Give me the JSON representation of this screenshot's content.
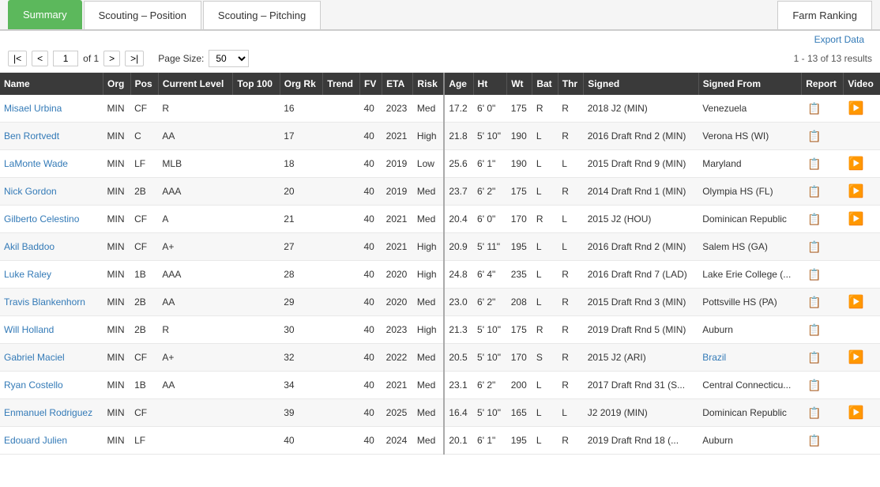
{
  "tabs": [
    {
      "label": "Summary",
      "active": true
    },
    {
      "label": "Scouting – Position",
      "active": false
    },
    {
      "label": "Scouting – Pitching",
      "active": false
    },
    {
      "label": "Farm Ranking",
      "active": false
    }
  ],
  "toolbar": {
    "export_label": "Export Data",
    "page_current": "1",
    "page_of": "of 1",
    "page_size_label": "Page Size:",
    "page_size_value": "50",
    "results_label": "1 - 13 of 13 results"
  },
  "table": {
    "headers": [
      "Name",
      "Org",
      "Pos",
      "Current Level",
      "Top 100",
      "Org Rk",
      "Trend",
      "FV",
      "ETA",
      "Risk",
      "Age",
      "Ht",
      "Wt",
      "Bat",
      "Thr",
      "Signed",
      "Signed From",
      "Report",
      "Video"
    ],
    "rows": [
      {
        "name": "Misael Urbina",
        "org": "MIN",
        "pos": "CF",
        "current_level": "R",
        "top100": "",
        "org_rk": "16",
        "trend": "",
        "fv": "40",
        "eta": "2023",
        "risk": "Med",
        "age": "17.2",
        "ht": "6' 0\"",
        "wt": "175",
        "bat": "R",
        "thr": "R",
        "signed": "2018 J2 (MIN)",
        "signed_from": "Venezuela",
        "has_report": true,
        "has_video": true,
        "signed_from_link": false
      },
      {
        "name": "Ben Rortvedt",
        "org": "MIN",
        "pos": "C",
        "current_level": "AA",
        "top100": "",
        "org_rk": "17",
        "trend": "",
        "fv": "40",
        "eta": "2021",
        "risk": "High",
        "age": "21.8",
        "ht": "5' 10\"",
        "wt": "190",
        "bat": "L",
        "thr": "R",
        "signed": "2016 Draft Rnd 2 (MIN)",
        "signed_from": "Verona HS (WI)",
        "has_report": true,
        "has_video": false,
        "signed_from_link": false
      },
      {
        "name": "LaMonte Wade",
        "org": "MIN",
        "pos": "LF",
        "current_level": "MLB",
        "top100": "",
        "org_rk": "18",
        "trend": "",
        "fv": "40",
        "eta": "2019",
        "risk": "Low",
        "age": "25.6",
        "ht": "6' 1\"",
        "wt": "190",
        "bat": "L",
        "thr": "L",
        "signed": "2015 Draft Rnd 9 (MIN)",
        "signed_from": "Maryland",
        "has_report": true,
        "has_video": true,
        "signed_from_link": false
      },
      {
        "name": "Nick Gordon",
        "org": "MIN",
        "pos": "2B",
        "current_level": "AAA",
        "top100": "",
        "org_rk": "20",
        "trend": "",
        "fv": "40",
        "eta": "2019",
        "risk": "Med",
        "age": "23.7",
        "ht": "6' 2\"",
        "wt": "175",
        "bat": "L",
        "thr": "R",
        "signed": "2014 Draft Rnd 1 (MIN)",
        "signed_from": "Olympia HS (FL)",
        "has_report": true,
        "has_video": true,
        "signed_from_link": false
      },
      {
        "name": "Gilberto Celestino",
        "org": "MIN",
        "pos": "CF",
        "current_level": "A",
        "top100": "",
        "org_rk": "21",
        "trend": "",
        "fv": "40",
        "eta": "2021",
        "risk": "Med",
        "age": "20.4",
        "ht": "6' 0\"",
        "wt": "170",
        "bat": "R",
        "thr": "L",
        "signed": "2015 J2 (HOU)",
        "signed_from": "Dominican Republic",
        "has_report": true,
        "has_video": true,
        "signed_from_link": false
      },
      {
        "name": "Akil Baddoo",
        "org": "MIN",
        "pos": "CF",
        "current_level": "A+",
        "top100": "",
        "org_rk": "27",
        "trend": "",
        "fv": "40",
        "eta": "2021",
        "risk": "High",
        "age": "20.9",
        "ht": "5' 11\"",
        "wt": "195",
        "bat": "L",
        "thr": "L",
        "signed": "2016 Draft Rnd 2 (MIN)",
        "signed_from": "Salem HS (GA)",
        "has_report": true,
        "has_video": false,
        "signed_from_link": false
      },
      {
        "name": "Luke Raley",
        "org": "MIN",
        "pos": "1B",
        "current_level": "AAA",
        "top100": "",
        "org_rk": "28",
        "trend": "",
        "fv": "40",
        "eta": "2020",
        "risk": "High",
        "age": "24.8",
        "ht": "6' 4\"",
        "wt": "235",
        "bat": "L",
        "thr": "R",
        "signed": "2016 Draft Rnd 7 (LAD)",
        "signed_from": "Lake Erie College (...",
        "has_report": true,
        "has_video": false,
        "signed_from_link": false
      },
      {
        "name": "Travis Blankenhorn",
        "org": "MIN",
        "pos": "2B",
        "current_level": "AA",
        "top100": "",
        "org_rk": "29",
        "trend": "",
        "fv": "40",
        "eta": "2020",
        "risk": "Med",
        "age": "23.0",
        "ht": "6' 2\"",
        "wt": "208",
        "bat": "L",
        "thr": "R",
        "signed": "2015 Draft Rnd 3 (MIN)",
        "signed_from": "Pottsville HS (PA)",
        "has_report": true,
        "has_video": true,
        "signed_from_link": false
      },
      {
        "name": "Will Holland",
        "org": "MIN",
        "pos": "2B",
        "current_level": "R",
        "top100": "",
        "org_rk": "30",
        "trend": "",
        "fv": "40",
        "eta": "2023",
        "risk": "High",
        "age": "21.3",
        "ht": "5' 10\"",
        "wt": "175",
        "bat": "R",
        "thr": "R",
        "signed": "2019 Draft Rnd 5 (MIN)",
        "signed_from": "Auburn",
        "has_report": true,
        "has_video": false,
        "signed_from_link": false
      },
      {
        "name": "Gabriel Maciel",
        "org": "MIN",
        "pos": "CF",
        "current_level": "A+",
        "top100": "",
        "org_rk": "32",
        "trend": "",
        "fv": "40",
        "eta": "2022",
        "risk": "Med",
        "age": "20.5",
        "ht": "5' 10\"",
        "wt": "170",
        "bat": "S",
        "thr": "R",
        "signed": "2015 J2 (ARI)",
        "signed_from": "Brazil",
        "has_report": true,
        "has_video": true,
        "signed_from_link": true
      },
      {
        "name": "Ryan Costello",
        "org": "MIN",
        "pos": "1B",
        "current_level": "AA",
        "top100": "",
        "org_rk": "34",
        "trend": "",
        "fv": "40",
        "eta": "2021",
        "risk": "Med",
        "age": "23.1",
        "ht": "6' 2\"",
        "wt": "200",
        "bat": "L",
        "thr": "R",
        "signed": "2017 Draft Rnd 31 (S...",
        "signed_from": "Central Connecticu...",
        "has_report": true,
        "has_video": false,
        "signed_from_link": false
      },
      {
        "name": "Enmanuel Rodriguez",
        "org": "MIN",
        "pos": "CF",
        "current_level": "",
        "top100": "",
        "org_rk": "39",
        "trend": "",
        "fv": "40",
        "eta": "2025",
        "risk": "Med",
        "age": "16.4",
        "ht": "5' 10\"",
        "wt": "165",
        "bat": "L",
        "thr": "L",
        "signed": "J2 2019 (MIN)",
        "signed_from": "Dominican Republic",
        "has_report": true,
        "has_video": true,
        "signed_from_link": false
      },
      {
        "name": "Edouard Julien",
        "org": "MIN",
        "pos": "LF",
        "current_level": "",
        "top100": "",
        "org_rk": "40",
        "trend": "",
        "fv": "40",
        "eta": "2024",
        "risk": "Med",
        "age": "20.1",
        "ht": "6' 1\"",
        "wt": "195",
        "bat": "L",
        "thr": "R",
        "signed": "2019 Draft Rnd 18 (...",
        "signed_from": "Auburn",
        "has_report": true,
        "has_video": false,
        "signed_from_link": false
      }
    ]
  }
}
